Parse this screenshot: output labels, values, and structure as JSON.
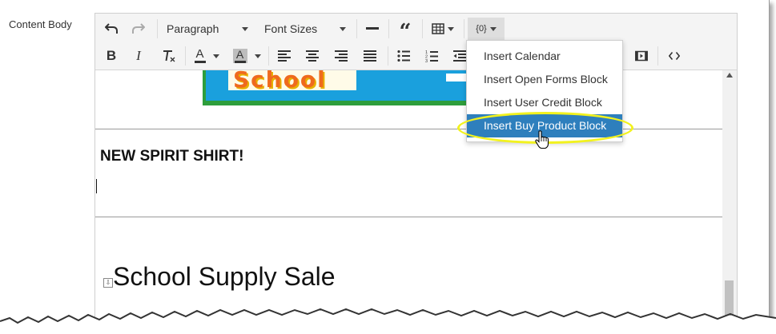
{
  "field": {
    "label": "Content Body"
  },
  "toolbar": {
    "row1": {
      "undo_icon": "undo-icon",
      "redo_icon": "redo-icon",
      "paragraph_label": "Paragraph",
      "fontsizes_label": "Font Sizes",
      "hr_icon": "horizontal-rule-icon",
      "blockquote_icon": "blockquote-icon",
      "table_icon": "table-icon",
      "variables_label": "{0}"
    },
    "row2": {
      "bold_icon": "bold-icon",
      "italic_icon": "italic-icon",
      "clear_format_icon": "clear-formatting-icon",
      "text_color_icon": "text-color-icon",
      "bg_color_icon": "background-color-icon",
      "align_left_icon": "align-left-icon",
      "align_center_icon": "align-center-icon",
      "align_right_icon": "align-right-icon",
      "align_justify_icon": "align-justify-icon",
      "bullet_list_icon": "bullet-list-icon",
      "numbered_list_icon": "numbered-list-icon",
      "outdent_icon": "outdent-icon",
      "media_icon": "media-icon",
      "source_code_icon": "source-code-icon"
    }
  },
  "dropdown": {
    "items": [
      {
        "label": "Insert Calendar",
        "active": false
      },
      {
        "label": "Insert Open Forms Block",
        "active": false
      },
      {
        "label": "Insert User Credit Block",
        "active": false
      },
      {
        "label": "Insert Buy Product Block",
        "active": true
      }
    ],
    "highlight_color": "#f2f21e",
    "active_color": "#2e7fbd"
  },
  "content": {
    "image_text": "School",
    "heading": "NEW SPIRIT SHIRT!",
    "sale_text": "School Supply Sale"
  }
}
